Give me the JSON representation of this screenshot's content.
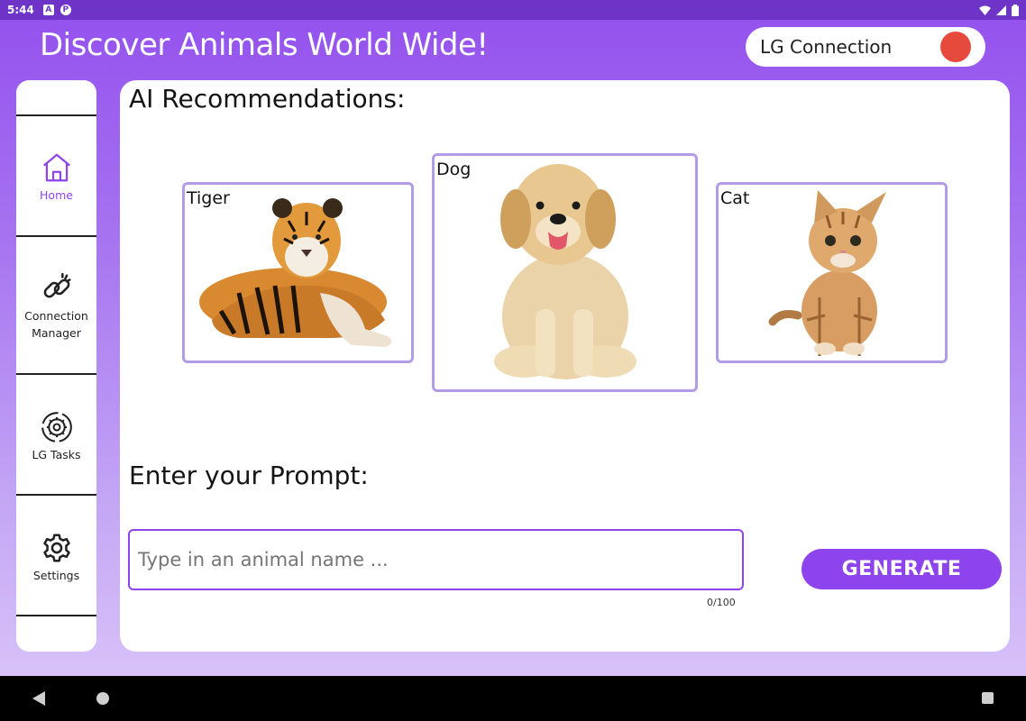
{
  "status_bar": {
    "time": "5:44",
    "icons": [
      "a-icon",
      "p-icon"
    ],
    "right_icons": [
      "wifi-icon",
      "signal-icon",
      "battery-icon"
    ]
  },
  "header": {
    "title": "Discover Animals World Wide!",
    "lg_connection_label": "LG Connection",
    "lg_status_color": "#e64a3c"
  },
  "sidebar": {
    "items": [
      {
        "label": "Home",
        "icon": "home-icon",
        "active": true
      },
      {
        "label": "Connection\nManager",
        "label_lines": [
          "Connection",
          "Manager"
        ],
        "icon": "link-icon",
        "active": false
      },
      {
        "label": "LG Tasks",
        "icon": "tasks-gear-icon",
        "active": false
      },
      {
        "label": "Settings",
        "icon": "gear-icon",
        "active": false
      }
    ]
  },
  "main": {
    "recommendations_heading": "AI Recommendations:",
    "cards": [
      {
        "label": "Tiger",
        "image": "tiger-image",
        "selected": false
      },
      {
        "label": "Dog",
        "image": "dog-image",
        "selected": true
      },
      {
        "label": "Cat",
        "image": "cat-image",
        "selected": false
      }
    ],
    "prompt_heading": "Enter your Prompt:",
    "prompt_input": {
      "value": "",
      "placeholder": "Type in an animal name ..."
    },
    "char_counter": "0/100",
    "generate_label": "GENERATE"
  },
  "colors": {
    "accent": "#8e44ec",
    "card_border": "#b49be6",
    "background_top": "#9350ee"
  }
}
